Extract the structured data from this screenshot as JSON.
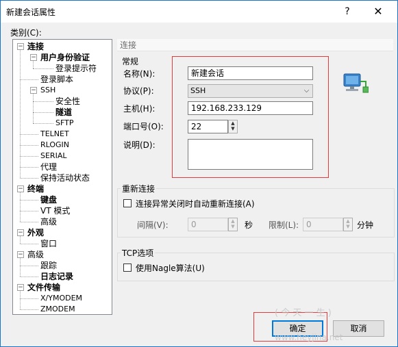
{
  "window": {
    "title": "新建会话属性",
    "help_glyph": "?",
    "close_glyph": "✕"
  },
  "category_label": "类别(C):",
  "tree": [
    {
      "label": "连接",
      "level": 0,
      "bold": true,
      "toggle": "minus"
    },
    {
      "label": "用户身份验证",
      "level": 1,
      "bold": true,
      "toggle": "minus"
    },
    {
      "label": "登录提示符",
      "level": 2
    },
    {
      "label": "登录脚本",
      "level": 1
    },
    {
      "label": "SSH",
      "level": 1,
      "toggle": "minus",
      "small": true
    },
    {
      "label": "安全性",
      "level": 2
    },
    {
      "label": "隧道",
      "level": 2,
      "bold": true
    },
    {
      "label": "SFTP",
      "level": 2,
      "small": true
    },
    {
      "label": "TELNET",
      "level": 1,
      "small": true
    },
    {
      "label": "RLOGIN",
      "level": 1,
      "small": true
    },
    {
      "label": "SERIAL",
      "level": 1,
      "small": true
    },
    {
      "label": "代理",
      "level": 1
    },
    {
      "label": "保持活动状态",
      "level": 1
    },
    {
      "label": "终端",
      "level": 0,
      "bold": true,
      "toggle": "minus"
    },
    {
      "label": "键盘",
      "level": 1,
      "bold": true
    },
    {
      "label": "VT 模式",
      "level": 1
    },
    {
      "label": "高级",
      "level": 1
    },
    {
      "label": "外观",
      "level": 0,
      "bold": true,
      "toggle": "minus"
    },
    {
      "label": "窗口",
      "level": 1
    },
    {
      "label": "高级",
      "level": 0,
      "toggle": "minus"
    },
    {
      "label": "跟踪",
      "level": 1
    },
    {
      "label": "日志记录",
      "level": 1,
      "bold": true
    },
    {
      "label": "文件传输",
      "level": 0,
      "bold": true,
      "toggle": "minus"
    },
    {
      "label": "X/YMODEM",
      "level": 1,
      "small": true
    },
    {
      "label": "ZMODEM",
      "level": 1,
      "small": true
    }
  ],
  "section_title": "连接",
  "general": {
    "group_label": "常规",
    "name_label": "名称(N):",
    "name_value": "新建会话",
    "protocol_label": "协议(P):",
    "protocol_value": "SSH",
    "host_label": "主机(H):",
    "host_value": "192.168.233.129",
    "port_label": "端口号(O):",
    "port_value": "22",
    "desc_label": "说明(D):",
    "desc_value": ""
  },
  "reconnect": {
    "group_label": "重新连接",
    "checkbox_label": "连接异常关闭时自动重新连接(A)",
    "interval_label": "间隔(V):",
    "interval_value": "0",
    "interval_unit": "秒",
    "limit_label": "限制(L):",
    "limit_value": "0",
    "limit_unit": "分钟"
  },
  "tcp": {
    "group_label": "TCP选项",
    "nagle_label": "使用Nagle算法(U)"
  },
  "buttons": {
    "ok": "确定",
    "cancel": "取消"
  },
  "icons": {
    "network": "network-computer-icon"
  },
  "colors": {
    "accent": "#0078d7",
    "highlight_box": "#e33b3b"
  }
}
